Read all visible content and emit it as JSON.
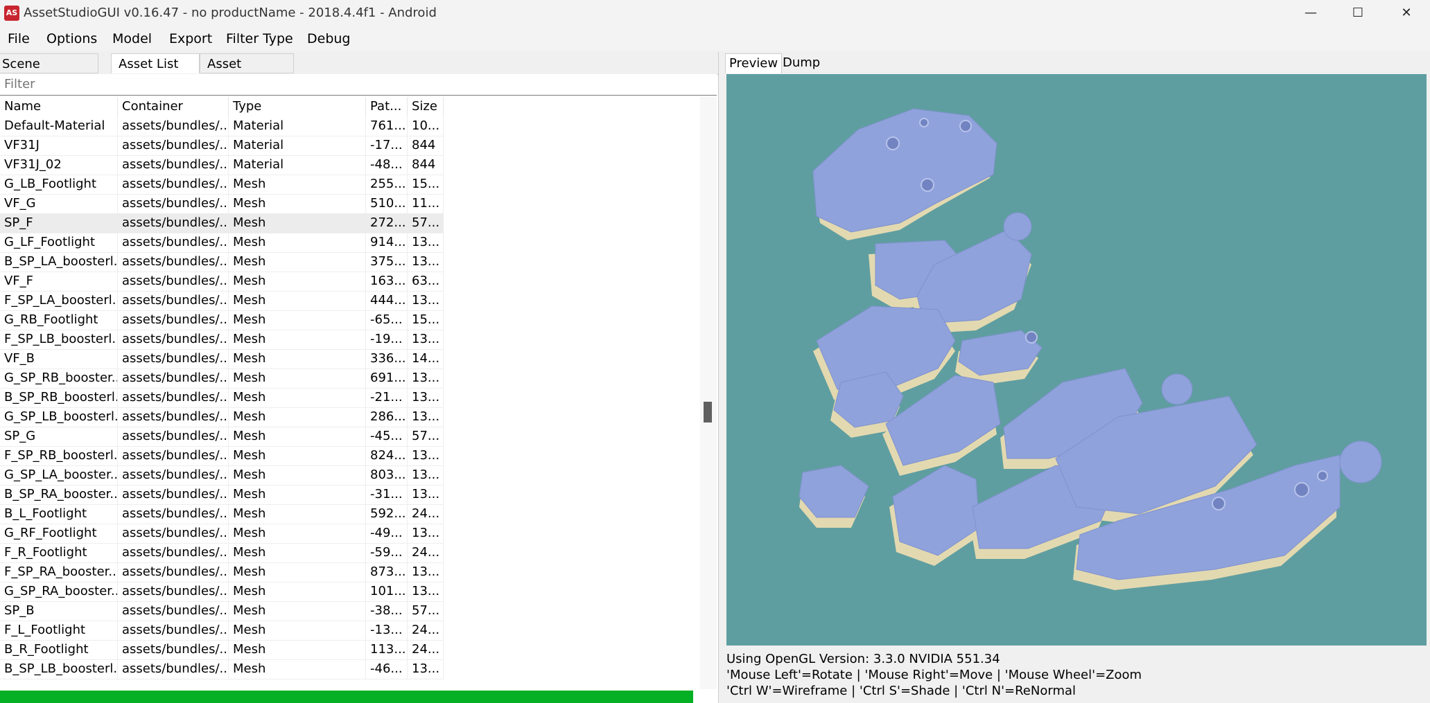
{
  "window": {
    "title": "AssetStudioGUI v0.16.47 - no productName - 2018.4.4f1 - Android",
    "icon_text": "AS",
    "minimize": "—",
    "maximize": "☐",
    "close": "✕"
  },
  "menu": [
    "File",
    "Options",
    "Model",
    "Export",
    "Filter Type",
    "Debug"
  ],
  "tabs": [
    "Scene Hierarchy",
    "Asset List",
    "Asset Classes"
  ],
  "filter": {
    "placeholder": "Filter"
  },
  "columns": [
    "Name",
    "Container",
    "Type",
    "Pat...",
    "Size"
  ],
  "rows": [
    [
      "Default-Material",
      "assets/bundles/...",
      "Material",
      "761...",
      "10..."
    ],
    [
      "VF31J",
      "assets/bundles/...",
      "Material",
      "-17...",
      "844"
    ],
    [
      "VF31J_02",
      "assets/bundles/...",
      "Material",
      "-48...",
      "844"
    ],
    [
      "G_LB_Footlight",
      "assets/bundles/...",
      "Mesh",
      "255...",
      "15..."
    ],
    [
      "VF_G",
      "assets/bundles/...",
      "Mesh",
      "510...",
      "11..."
    ],
    [
      "SP_F",
      "assets/bundles/...",
      "Mesh",
      "272...",
      "57..."
    ],
    [
      "G_LF_Footlight",
      "assets/bundles/...",
      "Mesh",
      "914...",
      "13..."
    ],
    [
      "B_SP_LA_boosterl...",
      "assets/bundles/...",
      "Mesh",
      "375...",
      "13..."
    ],
    [
      "VF_F",
      "assets/bundles/...",
      "Mesh",
      "163...",
      "63..."
    ],
    [
      "F_SP_LA_boosterl...",
      "assets/bundles/...",
      "Mesh",
      "444...",
      "13..."
    ],
    [
      "G_RB_Footlight",
      "assets/bundles/...",
      "Mesh",
      "-65...",
      "15..."
    ],
    [
      "F_SP_LB_boosterl...",
      "assets/bundles/...",
      "Mesh",
      "-19...",
      "13..."
    ],
    [
      "VF_B",
      "assets/bundles/...",
      "Mesh",
      "336...",
      "14..."
    ],
    [
      "G_SP_RB_booster...",
      "assets/bundles/...",
      "Mesh",
      "691...",
      "13..."
    ],
    [
      "B_SP_RB_boosterl...",
      "assets/bundles/...",
      "Mesh",
      "-21...",
      "13..."
    ],
    [
      "G_SP_LB_boosterl...",
      "assets/bundles/...",
      "Mesh",
      "286...",
      "13..."
    ],
    [
      "SP_G",
      "assets/bundles/...",
      "Mesh",
      "-45...",
      "57..."
    ],
    [
      "F_SP_RB_boosterl...",
      "assets/bundles/...",
      "Mesh",
      "824...",
      "13..."
    ],
    [
      "G_SP_LA_booster...",
      "assets/bundles/...",
      "Mesh",
      "803...",
      "13..."
    ],
    [
      "B_SP_RA_booster...",
      "assets/bundles/...",
      "Mesh",
      "-31...",
      "13..."
    ],
    [
      "B_L_Footlight",
      "assets/bundles/...",
      "Mesh",
      "592...",
      "24..."
    ],
    [
      "G_RF_Footlight",
      "assets/bundles/...",
      "Mesh",
      "-49...",
      "13..."
    ],
    [
      "F_R_Footlight",
      "assets/bundles/...",
      "Mesh",
      "-59...",
      "24..."
    ],
    [
      "F_SP_RA_booster...",
      "assets/bundles/...",
      "Mesh",
      "873...",
      "13..."
    ],
    [
      "G_SP_RA_booster...",
      "assets/bundles/...",
      "Mesh",
      "101...",
      "13..."
    ],
    [
      "SP_B",
      "assets/bundles/...",
      "Mesh",
      "-38...",
      "57..."
    ],
    [
      "F_L_Footlight",
      "assets/bundles/...",
      "Mesh",
      "-13...",
      "24..."
    ],
    [
      "B_R_Footlight",
      "assets/bundles/...",
      "Mesh",
      "113...",
      "24..."
    ],
    [
      "B_SP_LB_boosterl...",
      "assets/bundles/...",
      "Mesh",
      "-46...",
      "13..."
    ]
  ],
  "selected_row_index": 5,
  "progress": {
    "fraction": 1.0
  },
  "preview": {
    "tabs": [
      "Preview",
      "Dump"
    ],
    "info_lines": [
      "Using OpenGL Version: 3.3.0 NVIDIA 551.34",
      "'Mouse Left'=Rotate | 'Mouse Right'=Move | 'Mouse Wheel'=Zoom",
      "'Ctrl W'=Wireframe | 'Ctrl S'=Shade | 'Ctrl N'=ReNormal"
    ],
    "viewport_color": "#5f9ea0",
    "mesh_color": "#8fa2dc",
    "mesh_shade_color": "#e3d9b0"
  },
  "colors": {
    "progress_green": "#06b025",
    "selected_row": "#ececec"
  }
}
